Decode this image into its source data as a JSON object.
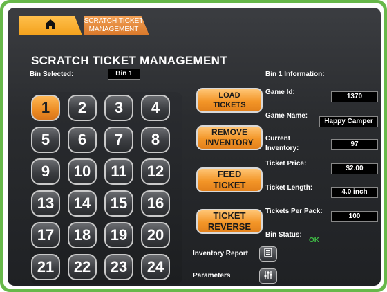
{
  "nav": {
    "home_icon": "home-icon",
    "tab_label_1": "SCRATCH TICKET",
    "tab_label_2": "MANAGEMENT"
  },
  "page": {
    "title": "SCRATCH TICKET MANAGEMENT",
    "bin_selected_label": "Bin Selected:",
    "bin_selected_value": "Bin 1"
  },
  "bins": [
    "1",
    "2",
    "3",
    "4",
    "5",
    "6",
    "7",
    "8",
    "9",
    "10",
    "11",
    "12",
    "13",
    "14",
    "15",
    "16",
    "17",
    "18",
    "19",
    "20",
    "21",
    "22",
    "23",
    "24"
  ],
  "selected_bin": "1",
  "actions": {
    "load_1": "LOAD",
    "load_2": "TICKETS",
    "remove_1": "REMOVE",
    "remove_2": "INVENTORY",
    "feed_1": "FEED",
    "feed_2": "TICKET",
    "reverse_1": "TICKET",
    "reverse_2": "REVERSE",
    "inventory_report": "Inventory Report",
    "parameters": "Parameters"
  },
  "info": {
    "heading": "Bin 1 Information:",
    "game_id_label": "Game Id:",
    "game_id": "1370",
    "game_name_label": "Game Name:",
    "game_name": "Happy Camper",
    "current_inventory_label_1": "Current",
    "current_inventory_label_2": "Inventory:",
    "current_inventory": "97",
    "ticket_price_label": "Ticket Price:",
    "ticket_price": "$2.00",
    "ticket_length_label": "Ticket Length:",
    "ticket_length": "4.0 inch",
    "tickets_per_pack_label": "Tickets Per Pack:",
    "tickets_per_pack": "100",
    "bin_status_label": "Bin Status:",
    "bin_status": "OK"
  },
  "colors": {
    "frame": "#67b84a",
    "accent_orange": "#f39628",
    "status_ok": "#3fbf45"
  }
}
